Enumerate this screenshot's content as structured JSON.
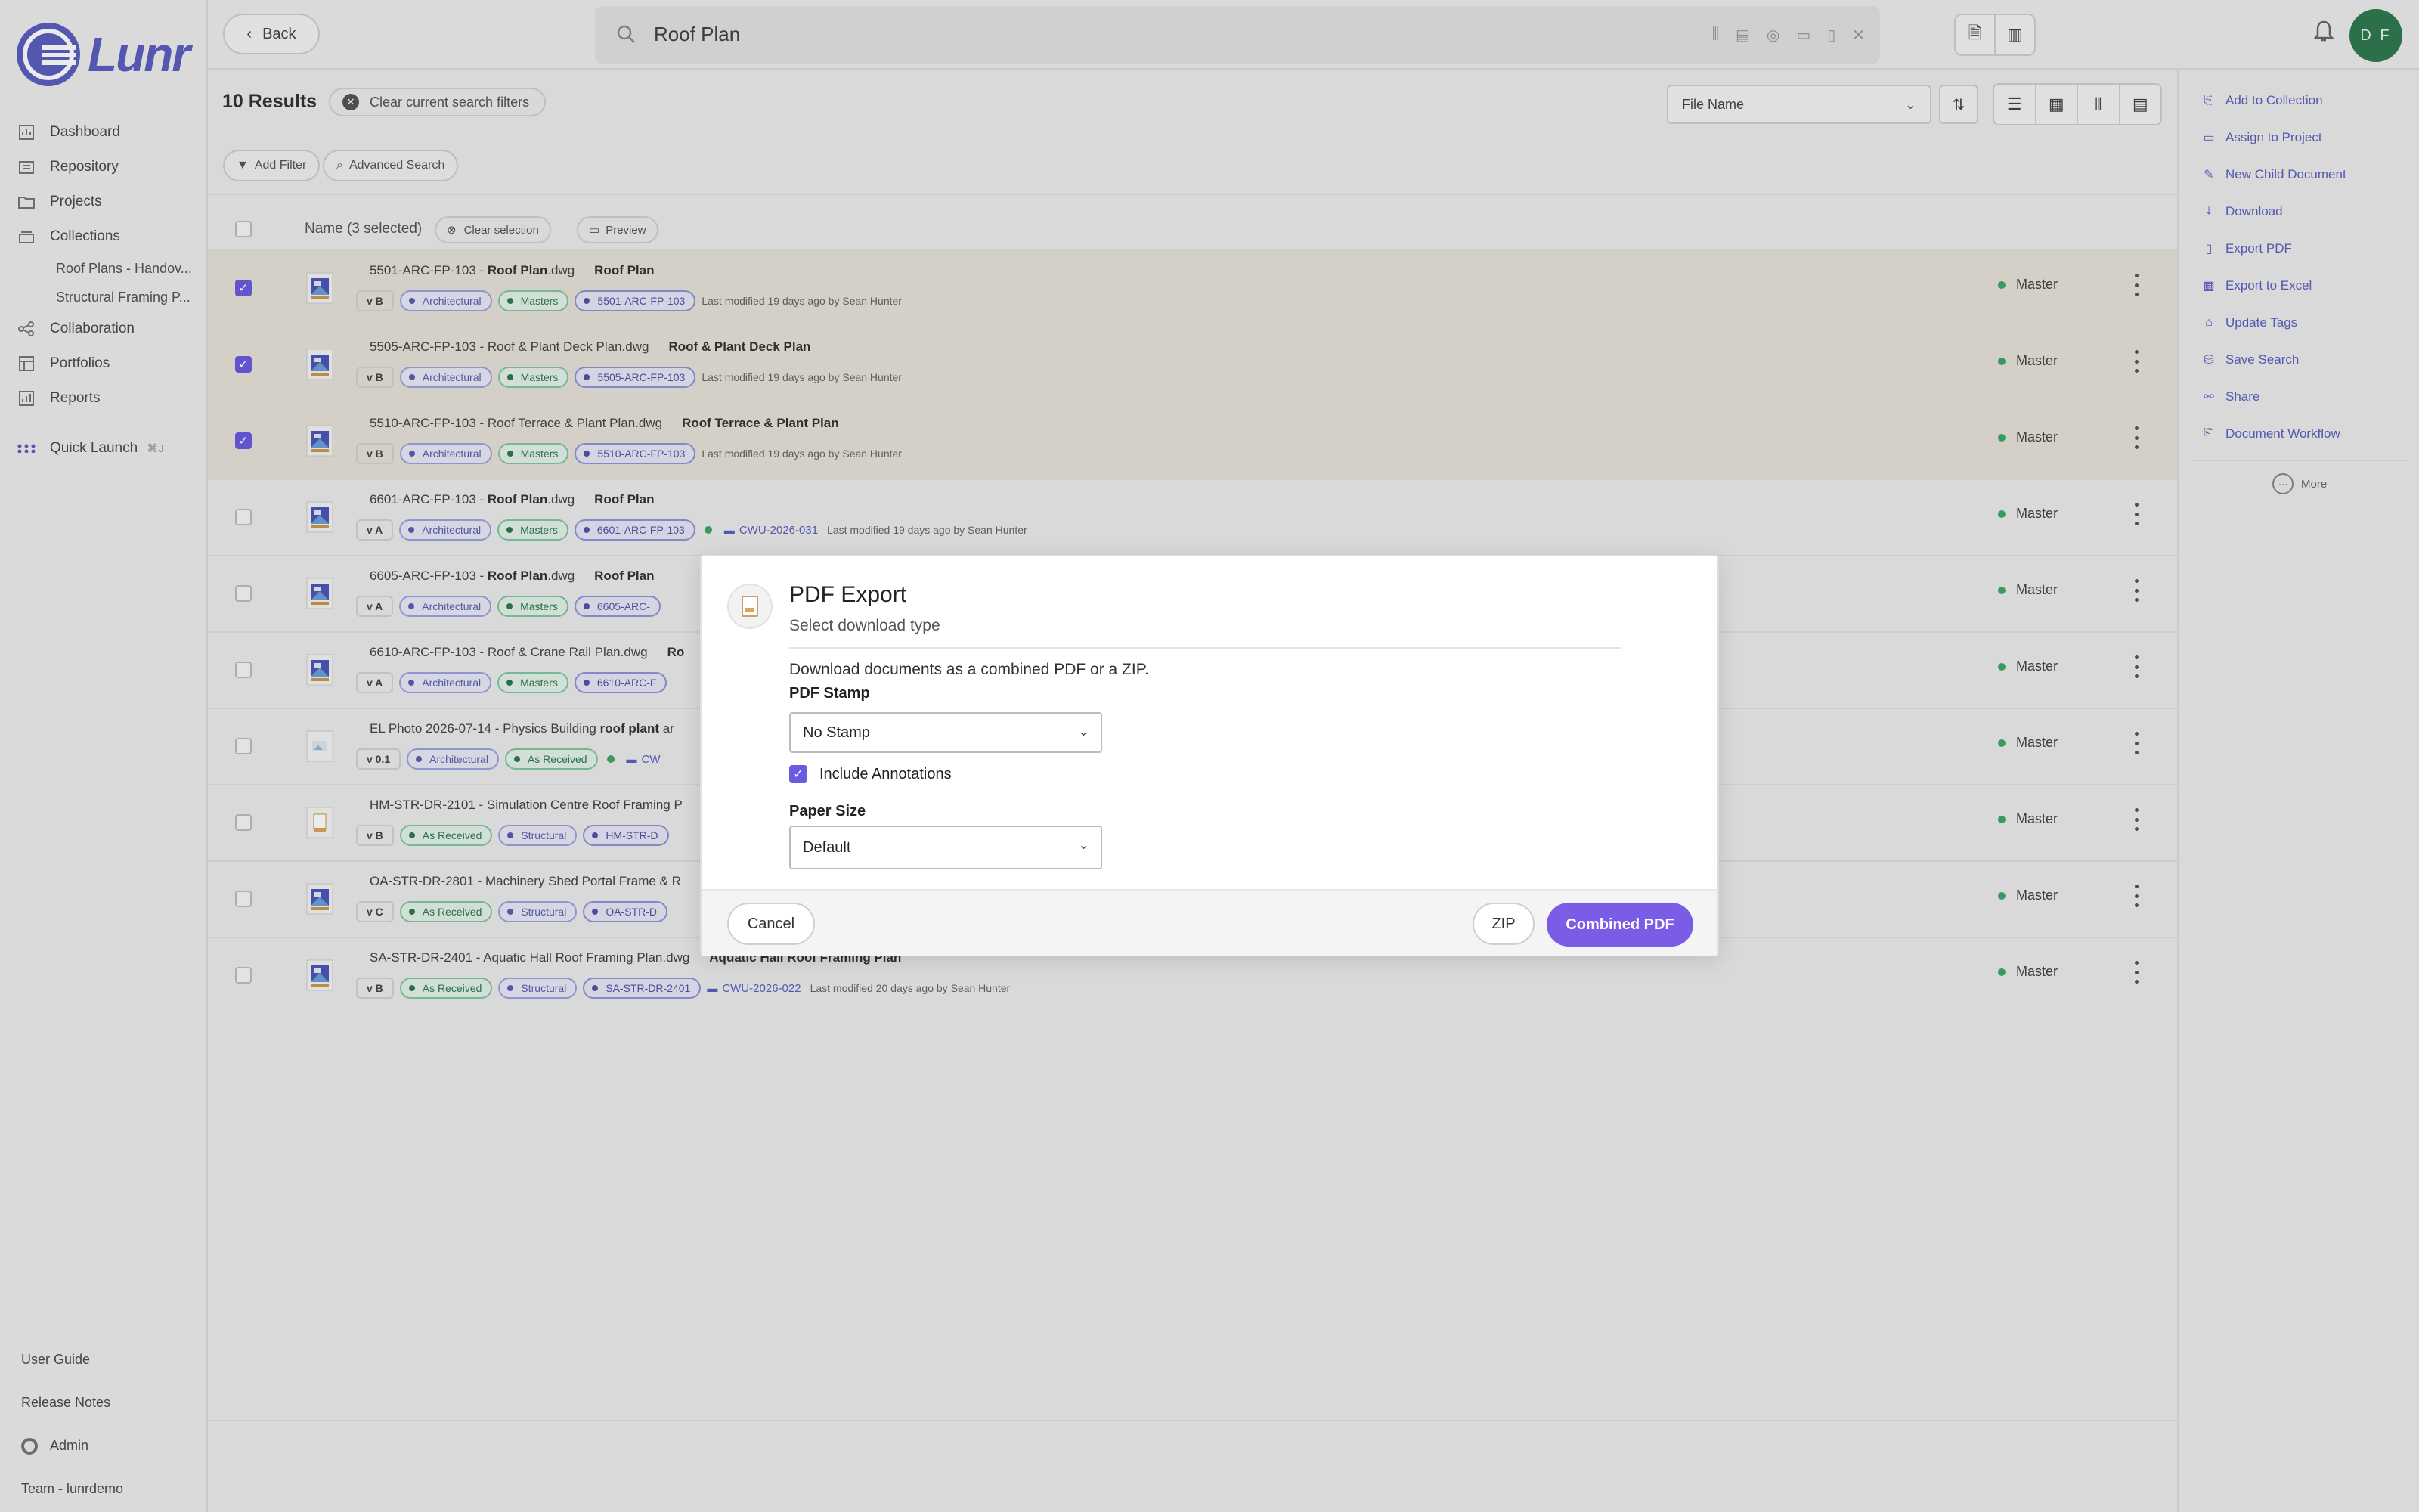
{
  "brand": {
    "name": "Lunr"
  },
  "sidebar": {
    "items": [
      {
        "label": "Dashboard",
        "icon": "dashboard-icon"
      },
      {
        "label": "Repository",
        "icon": "repository-icon"
      },
      {
        "label": "Projects",
        "icon": "folder-icon"
      },
      {
        "label": "Collections",
        "icon": "collections-icon"
      },
      {
        "label": "Collaboration",
        "icon": "share-icon"
      },
      {
        "label": "Portfolios",
        "icon": "portfolio-icon"
      },
      {
        "label": "Reports",
        "icon": "report-icon"
      }
    ],
    "collections": [
      "Roof Plans - Handov...",
      "Structural Framing P..."
    ],
    "quick_launch": {
      "label": "Quick Launch",
      "shortcut": "⌘J"
    },
    "bottom": {
      "user_guide": "User Guide",
      "release_notes": "Release Notes",
      "admin": "Admin",
      "team": "Team - lunrdemo"
    }
  },
  "topbar": {
    "back_label": "Back",
    "search_value": "Roof Plan",
    "avatar_initials": "D F"
  },
  "results": {
    "count_label": "10 Results",
    "clear_filters": "Clear current search filters",
    "sort_by": "File Name",
    "add_filter": "Add Filter",
    "advanced_search": "Advanced Search",
    "header_name": "Name (3 selected)",
    "clear_selection": "Clear selection",
    "preview": "Preview"
  },
  "rows": [
    {
      "selected": true,
      "prefix": "5501-ARC-FP-103 - ",
      "bold": "Roof Plan",
      "suffix": ".dwg",
      "desc": "Roof Plan",
      "version": "v B",
      "tags": [
        [
          "arch",
          "Architectural"
        ],
        [
          "mast",
          "Masters"
        ],
        [
          "docid",
          "5501-ARC-FP-103"
        ]
      ],
      "pin": false,
      "project": "",
      "modified": "Last modified 19 days ago by Sean Hunter",
      "status": "Master",
      "thumb": "dwg"
    },
    {
      "selected": true,
      "prefix": "5505-ARC-FP-103 - Roof & Plant Deck Plan.dwg",
      "bold": "",
      "suffix": "",
      "desc": "Roof & Plant Deck Plan",
      "version": "v B",
      "tags": [
        [
          "arch",
          "Architectural"
        ],
        [
          "mast",
          "Masters"
        ],
        [
          "docid",
          "5505-ARC-FP-103"
        ]
      ],
      "pin": false,
      "project": "",
      "modified": "Last modified 19 days ago by Sean Hunter",
      "status": "Master",
      "thumb": "dwg"
    },
    {
      "selected": true,
      "prefix": "5510-ARC-FP-103 - Roof Terrace & Plant Plan.dwg",
      "bold": "",
      "suffix": "",
      "desc": "Roof Terrace & Plant Plan",
      "version": "v B",
      "tags": [
        [
          "arch",
          "Architectural"
        ],
        [
          "mast",
          "Masters"
        ],
        [
          "docid",
          "5510-ARC-FP-103"
        ]
      ],
      "pin": false,
      "project": "",
      "modified": "Last modified 19 days ago by Sean Hunter",
      "status": "Master",
      "thumb": "dwg"
    },
    {
      "selected": false,
      "prefix": "6601-ARC-FP-103 - ",
      "bold": "Roof Plan",
      "suffix": ".dwg",
      "desc": "Roof Plan",
      "version": "v A",
      "tags": [
        [
          "arch",
          "Architectural"
        ],
        [
          "mast",
          "Masters"
        ],
        [
          "docid",
          "6601-ARC-FP-103"
        ]
      ],
      "pin": true,
      "project": "CWU-2026-031",
      "modified": "Last modified 19 days ago by Sean Hunter",
      "status": "Master",
      "thumb": "dwg"
    },
    {
      "selected": false,
      "prefix": "6605-ARC-FP-103 - ",
      "bold": "Roof Plan",
      "suffix": ".dwg",
      "desc": "Roof Plan",
      "version": "v A",
      "tags": [
        [
          "arch",
          "Architectural"
        ],
        [
          "mast",
          "Masters"
        ],
        [
          "docid",
          "6605-ARC-"
        ]
      ],
      "pin": false,
      "project": "",
      "modified": "",
      "status": "Master",
      "thumb": "dwg"
    },
    {
      "selected": false,
      "prefix": "6610-ARC-FP-103 - Roof & Crane Rail Plan.dwg",
      "bold": "",
      "suffix": "",
      "desc": "Ro",
      "version": "v A",
      "tags": [
        [
          "arch",
          "Architectural"
        ],
        [
          "mast",
          "Masters"
        ],
        [
          "docid",
          "6610-ARC-F"
        ]
      ],
      "pin": false,
      "project": "",
      "modified": "",
      "status": "Master",
      "thumb": "dwg"
    },
    {
      "selected": false,
      "prefix": "EL Photo 2026-07-14 - Physics Building ",
      "bold": "roof plant",
      "suffix": " ar",
      "desc": "",
      "version": "v 0.1",
      "tags": [
        [
          "arch",
          "Architectural"
        ],
        [
          "recv",
          "As Received"
        ]
      ],
      "pin": true,
      "project": "CW",
      "modified": "",
      "status": "Master",
      "thumb": "img"
    },
    {
      "selected": false,
      "prefix": "HM-STR-DR-2101 - Simulation Centre Roof Framing P",
      "bold": "",
      "suffix": "",
      "desc": "",
      "version": "v B",
      "tags": [
        [
          "recv",
          "As Received"
        ],
        [
          "stru",
          "Structural"
        ],
        [
          "docid",
          "HM-STR-D"
        ]
      ],
      "pin": false,
      "project": "",
      "modified": "",
      "status": "Master",
      "thumb": "pdf"
    },
    {
      "selected": false,
      "prefix": "OA-STR-DR-2801 - Machinery Shed Portal Frame & R",
      "bold": "",
      "suffix": "",
      "desc": "",
      "version": "v C",
      "tags": [
        [
          "recv",
          "As Received"
        ],
        [
          "stru",
          "Structural"
        ],
        [
          "docid",
          "OA-STR-D"
        ]
      ],
      "pin": false,
      "project": "",
      "modified": "",
      "status": "Master",
      "thumb": "dwg"
    },
    {
      "selected": false,
      "prefix": "SA-STR-DR-2401 - Aquatic Hall Roof Framing Plan.dwg",
      "bold": "",
      "suffix": "",
      "desc": "Aquatic Hall Roof Framing Plan",
      "version": "v B",
      "tags": [
        [
          "recv",
          "As Received"
        ],
        [
          "stru",
          "Structural"
        ],
        [
          "docid",
          "SA-STR-DR-2401"
        ]
      ],
      "pin": false,
      "project": "CWU-2026-022",
      "modified": "Last modified 20 days ago by Sean Hunter",
      "status": "Master",
      "thumb": "dwg"
    }
  ],
  "right_panel": {
    "actions": [
      {
        "label": "Add to Collection",
        "icon": "collection-icon"
      },
      {
        "label": "Assign to Project",
        "icon": "folder-icon"
      },
      {
        "label": "New Child Document",
        "icon": "pencil-icon"
      },
      {
        "label": "Download",
        "icon": "download-icon"
      },
      {
        "label": "Export PDF",
        "icon": "pdf-icon"
      },
      {
        "label": "Export to Excel",
        "icon": "excel-icon"
      },
      {
        "label": "Update Tags",
        "icon": "tag-icon"
      },
      {
        "label": "Save Search",
        "icon": "save-icon"
      },
      {
        "label": "Share",
        "icon": "share-icon"
      },
      {
        "label": "Document Workflow",
        "icon": "workflow-icon"
      }
    ],
    "more": "More"
  },
  "modal": {
    "title": "PDF Export",
    "subtitle": "Select download type",
    "description": "Download documents as a combined PDF or a ZIP.",
    "stamp_label": "PDF Stamp",
    "stamp_value": "No Stamp",
    "include_annotations": "Include Annotations",
    "paper_label": "Paper Size",
    "paper_value": "Default",
    "cancel": "Cancel",
    "zip": "ZIP",
    "combined": "Combined PDF"
  },
  "colors": {
    "accent": "#7b5ce6",
    "brand": "#5b5fbf",
    "status_green": "#3fa66a"
  }
}
